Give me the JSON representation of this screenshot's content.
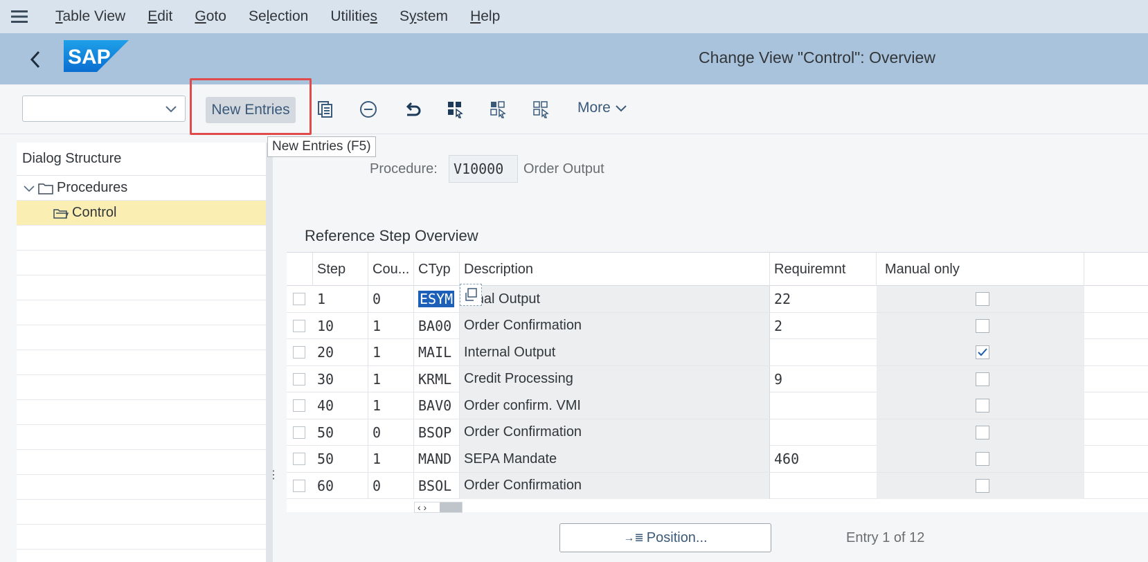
{
  "menu": {
    "items": [
      {
        "pre": "",
        "ul": "T",
        "post": "able View"
      },
      {
        "pre": "",
        "ul": "E",
        "post": "dit"
      },
      {
        "pre": "",
        "ul": "G",
        "post": "oto"
      },
      {
        "pre": "Se",
        "ul": "l",
        "post": "ection"
      },
      {
        "pre": "Utilitie",
        "ul": "s",
        "post": ""
      },
      {
        "pre": "S",
        "ul": "y",
        "post": "stem"
      },
      {
        "pre": "",
        "ul": "H",
        "post": "elp"
      }
    ]
  },
  "header": {
    "logo_text": "SAP",
    "title": "Change View \"Control\": Overview"
  },
  "toolbar": {
    "combo_value": "",
    "new_entries_label": "New Entries",
    "more_label": "More",
    "tooltip": "New Entries   (F5)"
  },
  "dialog_structure": {
    "title": "Dialog Structure",
    "items": [
      {
        "label": "Procedures"
      },
      {
        "label": "Control"
      }
    ]
  },
  "procedure": {
    "label": "Procedure:",
    "value": "V10000",
    "description": "Order Output"
  },
  "table": {
    "title": "Reference Step Overview",
    "columns": [
      "Step",
      "Cou...",
      "CTyp",
      "Description",
      "Requiremnt",
      "Manual only"
    ],
    "rows": [
      {
        "step": "1",
        "counter": "0",
        "ctyp": "ESYM",
        "description": "ernal Output",
        "requirement": "22",
        "manual_only": false
      },
      {
        "step": "10",
        "counter": "1",
        "ctyp": "BA00",
        "description": "Order Confirmation",
        "requirement": "2",
        "manual_only": false
      },
      {
        "step": "20",
        "counter": "1",
        "ctyp": "MAIL",
        "description": "Internal Output",
        "requirement": "",
        "manual_only": true
      },
      {
        "step": "30",
        "counter": "1",
        "ctyp": "KRML",
        "description": "Credit Processing",
        "requirement": "9",
        "manual_only": false
      },
      {
        "step": "40",
        "counter": "1",
        "ctyp": "BAV0",
        "description": "Order confirm.  VMI",
        "requirement": "",
        "manual_only": false
      },
      {
        "step": "50",
        "counter": "0",
        "ctyp": "BSOP",
        "description": "Order Confirmation",
        "requirement": "",
        "manual_only": false
      },
      {
        "step": "50",
        "counter": "1",
        "ctyp": "MAND",
        "description": "SEPA Mandate",
        "requirement": "460",
        "manual_only": false
      },
      {
        "step": "60",
        "counter": "0",
        "ctyp": "BSOL",
        "description": "Order Confirmation",
        "requirement": "",
        "manual_only": false
      }
    ]
  },
  "footer": {
    "position_label": "Position...",
    "entry_text": "Entry 1 of 12"
  },
  "colors": {
    "menubar": "#d9e3ed",
    "shell": "#a8c3db",
    "highlight": "#e04a4a",
    "selected_row": "#faeeb3"
  }
}
